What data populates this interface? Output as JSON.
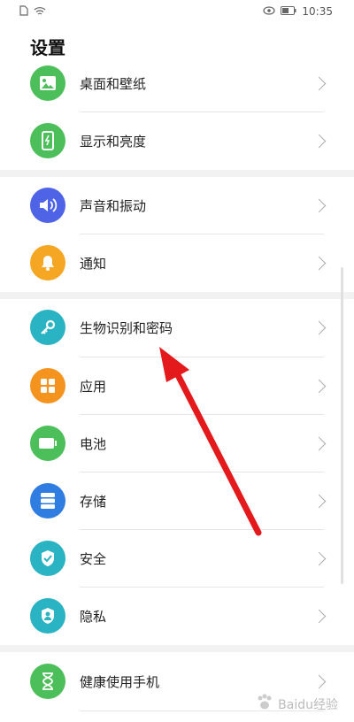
{
  "status_bar": {
    "time": "10:35",
    "left_icons": [
      "sim-icon",
      "wifi-icon"
    ],
    "right_icons": [
      "eye-icon",
      "battery-icon"
    ]
  },
  "page": {
    "title": "设置"
  },
  "items": [
    {
      "label": "桌面和壁纸",
      "icon": "image-icon",
      "color": "#4cbf5a"
    },
    {
      "label": "显示和亮度",
      "icon": "phone-display-icon",
      "color": "#4cbf5a"
    },
    {
      "label": "声音和振动",
      "icon": "volume-icon",
      "color": "#4f63e6"
    },
    {
      "label": "通知",
      "icon": "bell-icon",
      "color": "#f5a623"
    },
    {
      "label": "生物识别和密码",
      "icon": "key-icon",
      "color": "#2ab3c3"
    },
    {
      "label": "应用",
      "icon": "apps-grid-icon",
      "color": "#f5931f"
    },
    {
      "label": "电池",
      "icon": "battery-icon",
      "color": "#4cbf5a"
    },
    {
      "label": "存储",
      "icon": "storage-icon",
      "color": "#2f7de1"
    },
    {
      "label": "安全",
      "icon": "shield-check-icon",
      "color": "#2ab3c3"
    },
    {
      "label": "隐私",
      "icon": "privacy-shield-icon",
      "color": "#2ab3c3"
    },
    {
      "label": "健康使用手机",
      "icon": "hourglass-icon",
      "color": "#4cbf5a"
    }
  ],
  "watermark": {
    "text": "Baidu经验"
  },
  "annotation": {
    "arrow_color": "#e3191c"
  }
}
